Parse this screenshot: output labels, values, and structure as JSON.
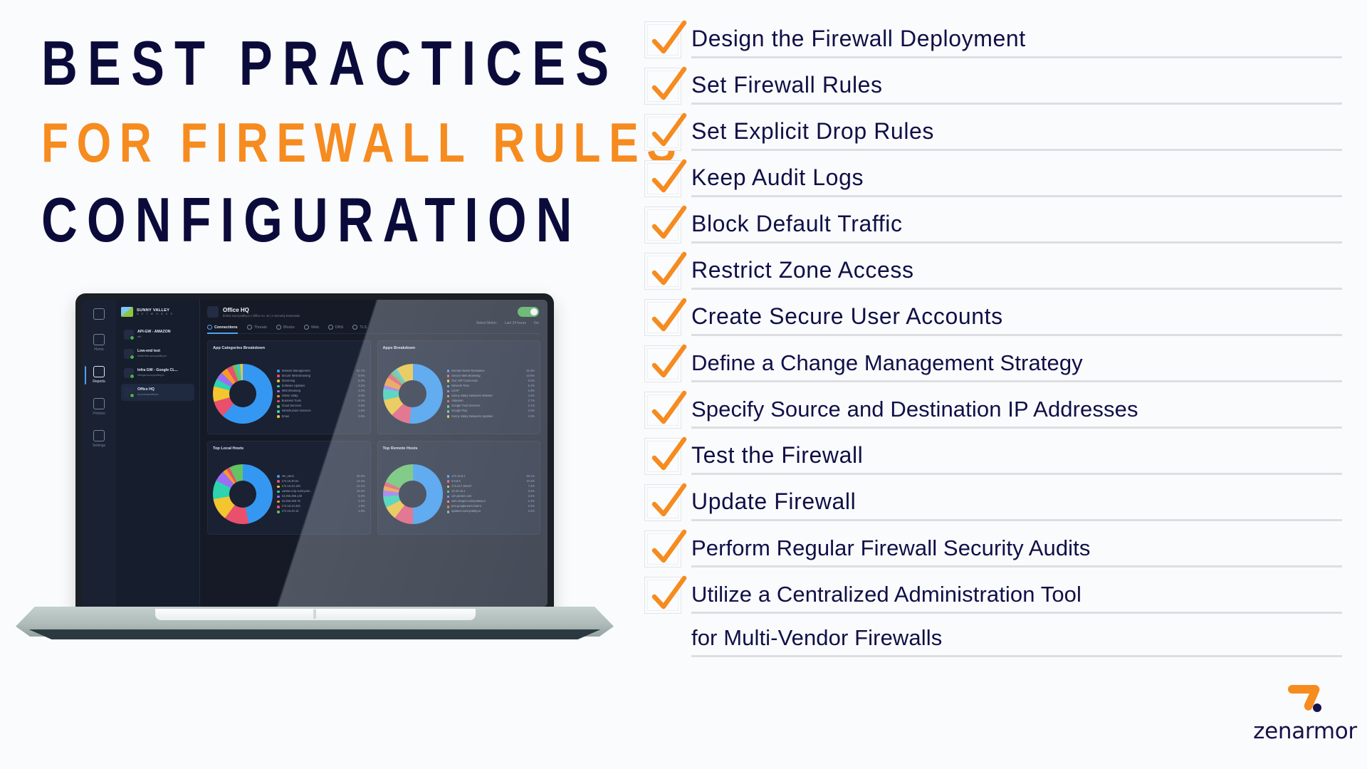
{
  "background_color": "#FAFBFC",
  "accent_orange": "#F68B1F",
  "navy": "#0B0B3B",
  "title": {
    "line1": "BEST PRACTICES",
    "line2": "FOR FIREWALL RULES",
    "line3": "CONFIGURATION"
  },
  "checklist": {
    "items": [
      {
        "label": "Design the Firewall Deployment"
      },
      {
        "label": "Set Firewall Rules"
      },
      {
        "label": "Set Explicit Drop Rules"
      },
      {
        "label": "Keep Audit Logs"
      },
      {
        "label": "Block Default Traffic"
      },
      {
        "label": "Restrict Zone Access"
      },
      {
        "label": "Create Secure User Accounts"
      },
      {
        "label": "Define a Change Management Strategy"
      },
      {
        "label": "Specify Source and Destination IP Addresses"
      },
      {
        "label": "Test the Firewall"
      },
      {
        "label": "Update Firewall"
      },
      {
        "label": "Perform Regular Firewall Security Audits"
      },
      {
        "label": "Utilize a Centralized Administration Tool",
        "continuation": "for Multi-Vendor Firewalls"
      }
    ]
  },
  "logo": {
    "wordmark": "zenarmor"
  },
  "laptop": {
    "dashboard": {
      "sidebar": [
        {
          "label": "Home"
        },
        {
          "label": "Reports"
        },
        {
          "label": "Policies"
        },
        {
          "label": "Settings"
        }
      ],
      "brand": {
        "name": "SUNNY VALLEY",
        "sub": "N E T W O R K S"
      },
      "devices": [
        {
          "name": "API-GW - AMAZON",
          "sub": "eth"
        },
        {
          "name": "Low-end test",
          "sub": "testonthe.sunnyvalley.io"
        },
        {
          "name": "Infra GW - Google CL...",
          "sub": "infragw.sunnyvalley.io"
        },
        {
          "name": "Office HQ",
          "sub": "hq.sunnyvalley.io"
        }
      ],
      "header": {
        "title": "Office HQ",
        "subtitle": "ferkos.sunnyvalley.io | Office no. 31 | A Security Essentials"
      },
      "toggle_state": "on",
      "tabs": [
        {
          "label": "Connections",
          "active": true
        },
        {
          "label": "Threats",
          "active": false
        },
        {
          "label": "Blocks",
          "active": false
        },
        {
          "label": "Web",
          "active": false
        },
        {
          "label": "DNS",
          "active": false
        },
        {
          "label": "TLS",
          "active": false
        }
      ],
      "toolbar": [
        {
          "label": "Select Metric"
        },
        {
          "label": "Last 24 hours"
        },
        {
          "label": "5m"
        }
      ],
      "cards": [
        {
          "title": "App Categories Breakdown",
          "legend": [
            {
              "name": "Network Management",
              "value": "61.7%",
              "color": "#3498f3"
            },
            {
              "name": "Secure Web Browsing",
              "value": "9.0%",
              "color": "#e8506e"
            },
            {
              "name": "Streaming",
              "value": "8.3%",
              "color": "#f3c62f"
            },
            {
              "name": "Software Updates",
              "value": "4.2%",
              "color": "#2ed3b0"
            },
            {
              "name": "Web Browsing",
              "value": "4.2%",
              "color": "#9b6ef3"
            },
            {
              "name": "Online Utility",
              "value": "3.6%",
              "color": "#f79a2b"
            },
            {
              "name": "Business Tools",
              "value": "3.4%",
              "color": "#e8506e"
            },
            {
              "name": "Cloud Services",
              "value": "2.6%",
              "color": "#62c462"
            },
            {
              "name": "Infrastructure Services",
              "value": "1.6%",
              "color": "#45c6d8"
            },
            {
              "name": "Email",
              "value": "0.8%",
              "color": "#f3c62f"
            }
          ]
        },
        {
          "title": "Apps Breakdown",
          "legend": [
            {
              "name": "Domain Name Resolution",
              "value": "51.9%",
              "color": "#3498f3"
            },
            {
              "name": "Secure Web Browsing",
              "value": "10.5%",
              "color": "#e8506e"
            },
            {
              "name": "Out: SIP Connection",
              "value": "9.2%",
              "color": "#f3c62f"
            },
            {
              "name": "Network Time",
              "value": "6.1%",
              "color": "#2ed3b0"
            },
            {
              "name": "LDAP",
              "value": "1.9%",
              "color": "#9b6ef3"
            },
            {
              "name": "Sunny Valley Networks Website",
              "value": "4.4%",
              "color": "#f79a2b"
            },
            {
              "name": "Atlassian",
              "value": "2.7%",
              "color": "#e8506e"
            },
            {
              "name": "Google Trust Services",
              "value": "2.1%",
              "color": "#62c462"
            },
            {
              "name": "Google Play",
              "value": "2.0%",
              "color": "#45c6d8"
            },
            {
              "name": "Sunny Valley Networks Updates",
              "value": "2.0%",
              "color": "#f3c62f"
            }
          ]
        }
      ],
      "cards_bottom": [
        {
          "title": "Top Local Hosts",
          "legend": [
            {
              "name": "efe_silesi",
              "value": "46.8%",
              "color": "#3498f3"
            },
            {
              "name": "172.16.40.61",
              "value": "13.4%",
              "color": "#e8506e"
            },
            {
              "name": "172.16.43.100",
              "value": "12.1%",
              "color": "#f3c62f"
            },
            {
              "name": "vanilla.corp.sunnyvall...",
              "value": "10.2%",
              "color": "#2ed3b0"
            },
            {
              "name": "10.255.255.130",
              "value": "6.0%",
              "color": "#9b6ef3"
            },
            {
              "name": "10.255.255.76",
              "value": "2.2%",
              "color": "#f79a2b"
            },
            {
              "name": "172.16.43.202",
              "value": "1.9%",
              "color": "#e8506e"
            },
            {
              "name": "172.16.43.12",
              "value": "1.9%",
              "color": "#62c462"
            }
          ]
        },
        {
          "title": "Top Remote Hosts",
          "legend": [
            {
              "name": "172.16.8.1",
              "value": "30.1%",
              "color": "#3498f3"
            },
            {
              "name": "8.8.8.8",
              "value": "10.3%",
              "color": "#e8506e"
            },
            {
              "name": "172.217.169.67",
              "value": "7.2%",
              "color": "#f3c62f"
            },
            {
              "name": "10.43.43.1",
              "value": "6.2%",
              "color": "#2ed3b0"
            },
            {
              "name": "cdn.pardot.com",
              "value": "3.2%",
              "color": "#9b6ef3"
            },
            {
              "name": "web.ranges.sunnyvalley.io",
              "value": "2.4%",
              "color": "#f79a2b"
            },
            {
              "name": "pho.googleusercontent",
              "value": "2.3%",
              "color": "#e8506e"
            },
            {
              "name": "updates.sunnyvalley.io",
              "value": "2.2%",
              "color": "#62c462"
            }
          ]
        }
      ]
    }
  }
}
